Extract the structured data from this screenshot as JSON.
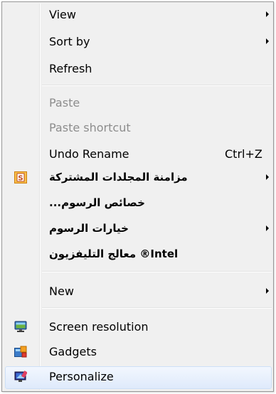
{
  "context_menu": {
    "items": [
      {
        "label": "View",
        "submenu": true
      },
      {
        "label": "Sort by",
        "submenu": true
      },
      {
        "label": "Refresh"
      },
      {
        "label": "Paste",
        "disabled": true
      },
      {
        "label": "Paste shortcut",
        "disabled": true
      },
      {
        "label": "Undo Rename",
        "shortcut": "Ctrl+Z"
      },
      {
        "label": "مزامنة المجلدات المشتركة",
        "icon": "shared-folders-sync-icon",
        "submenu": true
      },
      {
        "label": "خصائص الرسوم...",
        "display": "...خصائص الرسوم"
      },
      {
        "label": "خيارات الرسوم",
        "submenu": true
      },
      {
        "label": "Intel® معالج التليفزيون",
        "display": "للتليفزيون Intel® معالج"
      },
      {
        "label": "New",
        "submenu": true
      },
      {
        "label": "Screen resolution",
        "icon": "screen-resolution-icon"
      },
      {
        "label": "Gadgets",
        "icon": "gadgets-icon"
      },
      {
        "label": "Personalize",
        "icon": "personalize-icon",
        "highlighted": true
      }
    ]
  },
  "colors": {
    "menu_background": "#f0f0f0",
    "menu_border": "#979797",
    "disabled_text": "#8d8d8d",
    "highlight": "#dfeafb"
  }
}
